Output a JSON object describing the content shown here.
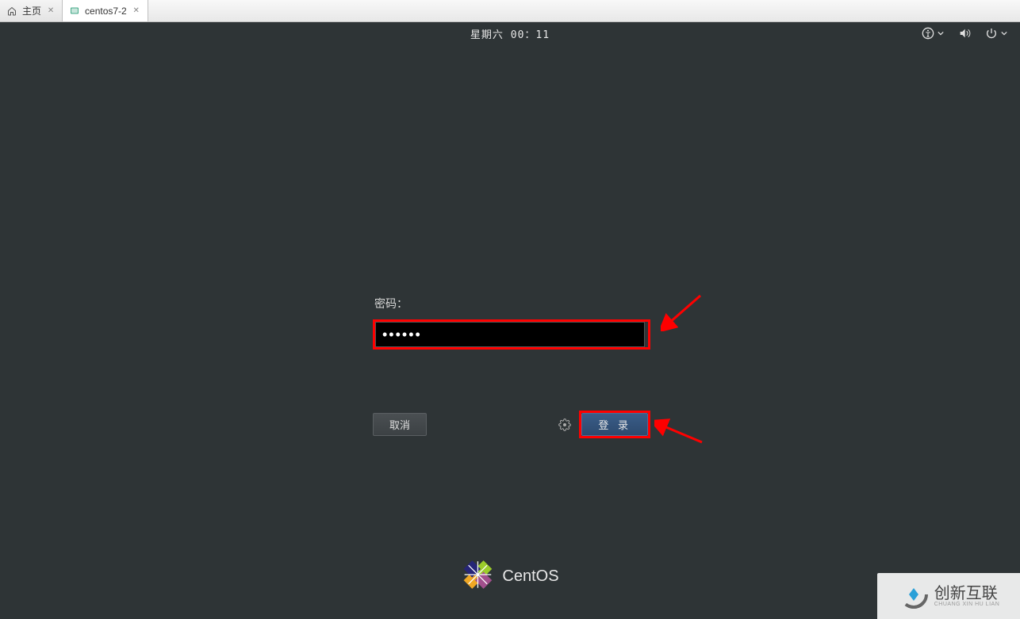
{
  "tabs": [
    {
      "label": "主页",
      "icon": "home"
    },
    {
      "label": "centos7-2",
      "icon": "vm"
    }
  ],
  "topbar": {
    "datetime": "星期六 00：11"
  },
  "login": {
    "password_label": "密码：",
    "password_value": "●●●●●●",
    "cancel_label": "取消",
    "login_label": "登 录"
  },
  "footer": {
    "brand": "CentOS"
  },
  "watermark": {
    "main": "创新互联",
    "sub": "CHUANG XIN HU LIAN"
  },
  "annotation": {
    "highlight_color": "#ff0000"
  }
}
